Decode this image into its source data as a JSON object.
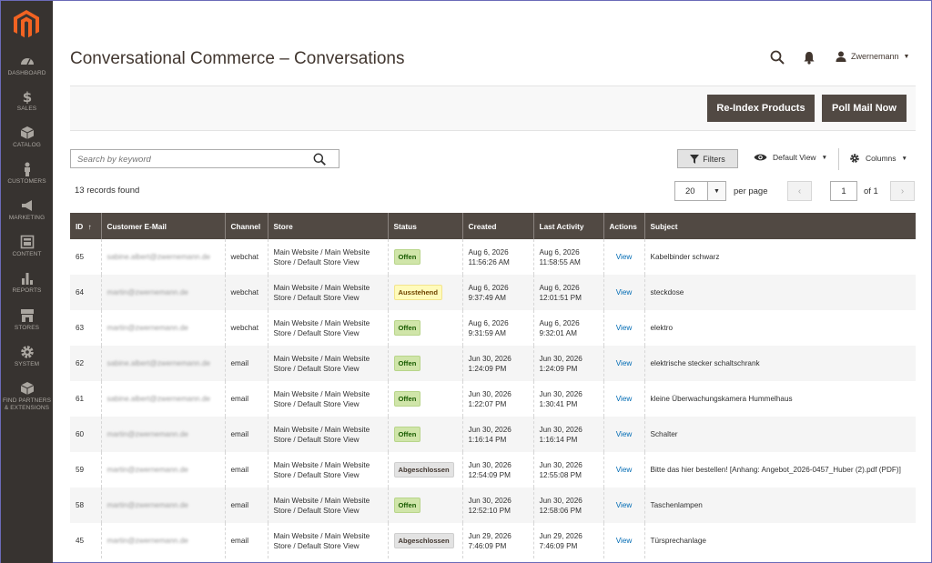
{
  "sidebar": {
    "items": [
      {
        "label": "DASHBOARD",
        "icon": "dashboard-icon"
      },
      {
        "label": "SALES",
        "icon": "dollar-icon"
      },
      {
        "label": "CATALOG",
        "icon": "cube-icon"
      },
      {
        "label": "CUSTOMERS",
        "icon": "person-icon"
      },
      {
        "label": "MARKETING",
        "icon": "megaphone-icon"
      },
      {
        "label": "CONTENT",
        "icon": "layout-icon"
      },
      {
        "label": "REPORTS",
        "icon": "bar-chart-icon"
      },
      {
        "label": "STORES",
        "icon": "storefront-icon"
      },
      {
        "label": "SYSTEM",
        "icon": "gear-icon"
      },
      {
        "label": "FIND PARTNERS & EXTENSIONS",
        "icon": "box-icon"
      }
    ]
  },
  "header": {
    "title": "Conversational Commerce – Conversations",
    "user": "Zwernemann"
  },
  "actions": {
    "reindex_label": "Re-Index Products",
    "poll_label": "Poll Mail Now"
  },
  "toolbar": {
    "search_placeholder": "Search by keyword",
    "filters_label": "Filters",
    "view_label": "Default View",
    "columns_label": "Columns",
    "records_found": "13 records found",
    "per_page_value": "20",
    "per_page_label": "per page",
    "page_current": "1",
    "page_of": "of 1"
  },
  "table": {
    "columns": [
      "ID",
      "Customer E-Mail",
      "Channel",
      "Store",
      "Status",
      "Created",
      "Last Activity",
      "Actions",
      "Subject"
    ],
    "sort_indicator": "↑",
    "rows": [
      {
        "id": "65",
        "email": "sabine.albert@zwernemann.de",
        "channel": "webchat",
        "store_1": "Main Website / Main Website",
        "store_2": "Store / Default Store View",
        "status": "Offen",
        "status_type": "offen",
        "created_1": "Aug 6, 2026",
        "created_2": "11:56:26 AM",
        "last_1": "Aug 6, 2026",
        "last_2": "11:58:55 AM",
        "action": "View",
        "subject": "Kabelbinder schwarz"
      },
      {
        "id": "64",
        "email": "martin@zwernemann.de",
        "channel": "webchat",
        "store_1": "Main Website / Main Website",
        "store_2": "Store / Default Store View",
        "status": "Ausstehend",
        "status_type": "aus",
        "created_1": "Aug 6, 2026",
        "created_2": "9:37:49 AM",
        "last_1": "Aug 6, 2026",
        "last_2": "12:01:51 PM",
        "action": "View",
        "subject": "steckdose"
      },
      {
        "id": "63",
        "email": "martin@zwernemann.de",
        "channel": "webchat",
        "store_1": "Main Website / Main Website",
        "store_2": "Store / Default Store View",
        "status": "Offen",
        "status_type": "offen",
        "created_1": "Aug 6, 2026",
        "created_2": "9:31:59 AM",
        "last_1": "Aug 6, 2026",
        "last_2": "9:32:01 AM",
        "action": "View",
        "subject": "elektro"
      },
      {
        "id": "62",
        "email": "sabine.albert@zwernemann.de",
        "channel": "email",
        "store_1": "Main Website / Main Website",
        "store_2": "Store / Default Store View",
        "status": "Offen",
        "status_type": "offen",
        "created_1": "Jun 30, 2026",
        "created_2": "1:24:09 PM",
        "last_1": "Jun 30, 2026",
        "last_2": "1:24:09 PM",
        "action": "View",
        "subject": "elektrische stecker schaltschrank"
      },
      {
        "id": "61",
        "email": "sabine.albert@zwernemann.de",
        "channel": "email",
        "store_1": "Main Website / Main Website",
        "store_2": "Store / Default Store View",
        "status": "Offen",
        "status_type": "offen",
        "created_1": "Jun 30, 2026",
        "created_2": "1:22:07 PM",
        "last_1": "Jun 30, 2026",
        "last_2": "1:30:41 PM",
        "action": "View",
        "subject": "kleine Überwachungskamera Hummelhaus"
      },
      {
        "id": "60",
        "email": "martin@zwernemann.de",
        "channel": "email",
        "store_1": "Main Website / Main Website",
        "store_2": "Store / Default Store View",
        "status": "Offen",
        "status_type": "offen",
        "created_1": "Jun 30, 2026",
        "created_2": "1:16:14 PM",
        "last_1": "Jun 30, 2026",
        "last_2": "1:16:14 PM",
        "action": "View",
        "subject": "Schalter"
      },
      {
        "id": "59",
        "email": "martin@zwernemann.de",
        "channel": "email",
        "store_1": "Main Website / Main Website",
        "store_2": "Store / Default Store View",
        "status": "Abgeschlossen",
        "status_type": "abg",
        "created_1": "Jun 30, 2026",
        "created_2": "12:54:09 PM",
        "last_1": "Jun 30, 2026",
        "last_2": "12:55:08 PM",
        "action": "View",
        "subject": "Bitte das hier bestellen! [Anhang: Angebot_2026-0457_Huber (2).pdf (PDF)]"
      },
      {
        "id": "58",
        "email": "martin@zwernemann.de",
        "channel": "email",
        "store_1": "Main Website / Main Website",
        "store_2": "Store / Default Store View",
        "status": "Offen",
        "status_type": "offen",
        "created_1": "Jun 30, 2026",
        "created_2": "12:52:10 PM",
        "last_1": "Jun 30, 2026",
        "last_2": "12:58:06 PM",
        "action": "View",
        "subject": "Taschenlampen"
      },
      {
        "id": "45",
        "email": "martin@zwernemann.de",
        "channel": "email",
        "store_1": "Main Website / Main Website",
        "store_2": "Store / Default Store View",
        "status": "Abgeschlossen",
        "status_type": "abg",
        "created_1": "Jun 29, 2026",
        "created_2": "7:46:09 PM",
        "last_1": "Jun 29, 2026",
        "last_2": "7:46:09 PM",
        "action": "View",
        "subject": "Türsprechanlage"
      }
    ]
  }
}
